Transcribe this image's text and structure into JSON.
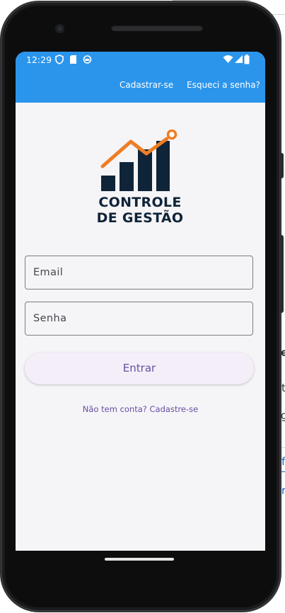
{
  "status_bar": {
    "time": "12:29",
    "left_icons": [
      "shield-icon",
      "sim-card-icon",
      "sync-icon"
    ],
    "right_icons": [
      "wifi-icon",
      "signal-icon",
      "battery-icon"
    ]
  },
  "app_bar": {
    "actions": [
      {
        "label": "Cadastrar-se"
      },
      {
        "label": "Esqueci a senha?"
      }
    ],
    "color": "#2b95ec"
  },
  "logo": {
    "line1": "CONTROLE",
    "line2": "DE GESTÃO",
    "dark_color": "#0f2438",
    "accent_color": "#ef7d23"
  },
  "form": {
    "email_placeholder": "Email",
    "email_value": "",
    "password_placeholder": "Senha",
    "password_value": "",
    "submit_label": "Entrar",
    "signup_link": "Não tem conta? Cadastre-se"
  },
  "accent": "#6750a4",
  "background_fragments": [
    "e",
    "t",
    "g",
    "f",
    "r"
  ]
}
